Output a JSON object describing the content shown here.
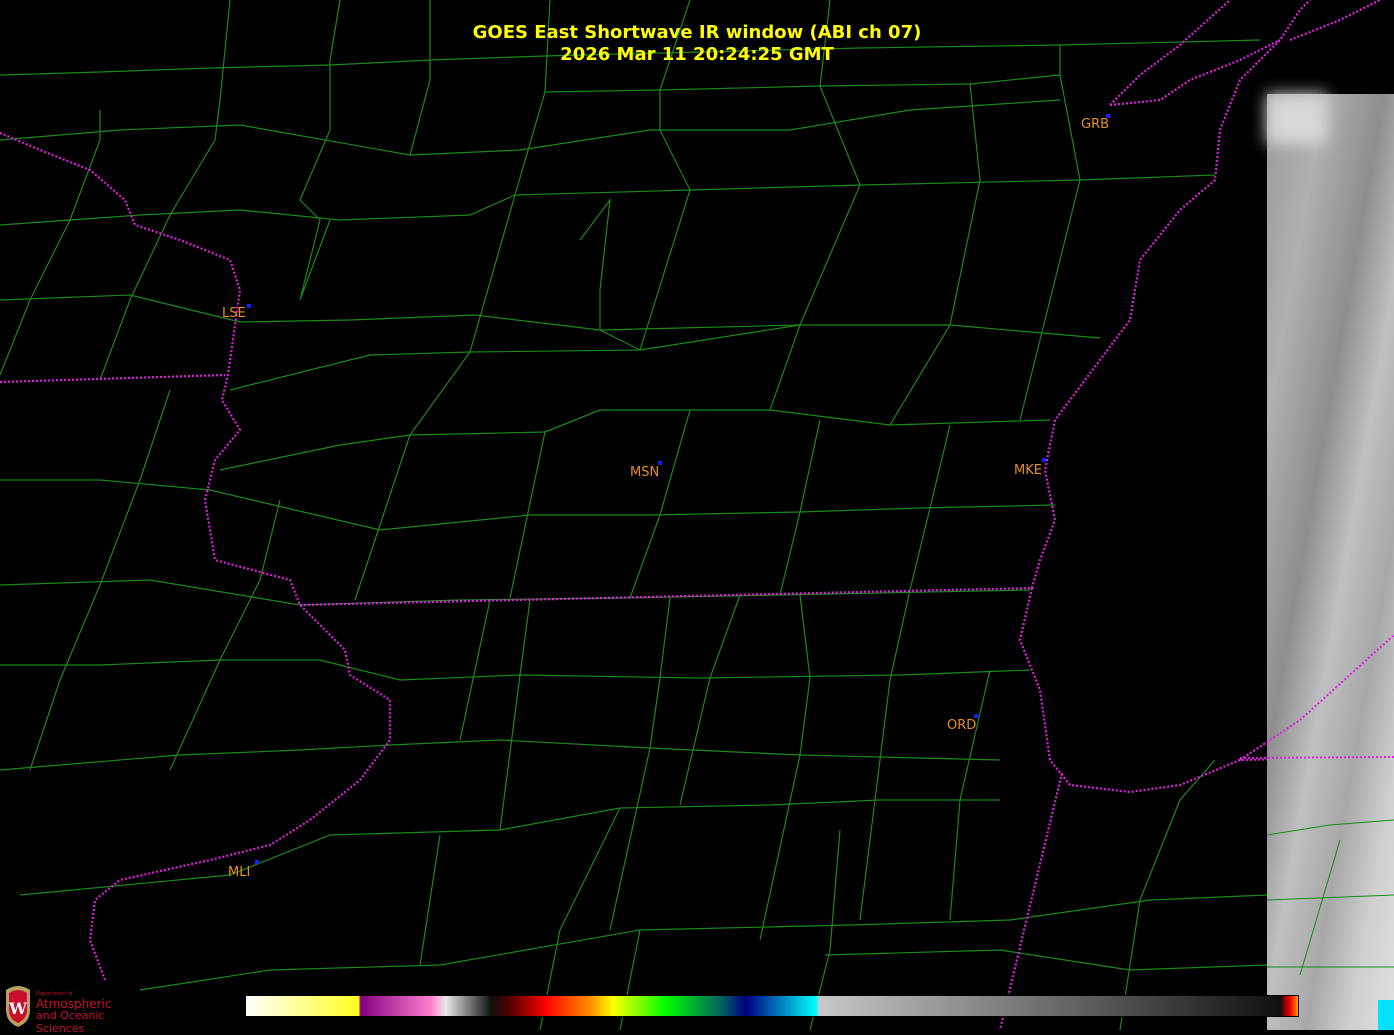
{
  "title": {
    "line1": "GOES East Shortwave IR window (ABI ch 07)",
    "line2": "2026 Mar 11  20:24:25 GMT"
  },
  "stations": [
    {
      "code": "GRB"
    },
    {
      "code": "LSE"
    },
    {
      "code": "MSN"
    },
    {
      "code": "MKE"
    },
    {
      "code": "ORD"
    },
    {
      "code": "MLI"
    }
  ],
  "logo": {
    "dept": "Department of",
    "line1": "Atmospheric",
    "line2": "and Oceanic Sciences",
    "seal_letter": "W"
  },
  "colors": {
    "title": "#ffff00",
    "station_label": "#e8901c",
    "station_dot": "#1020ff",
    "state_border": "#e020e0",
    "county_border": "#1a8a1a"
  }
}
